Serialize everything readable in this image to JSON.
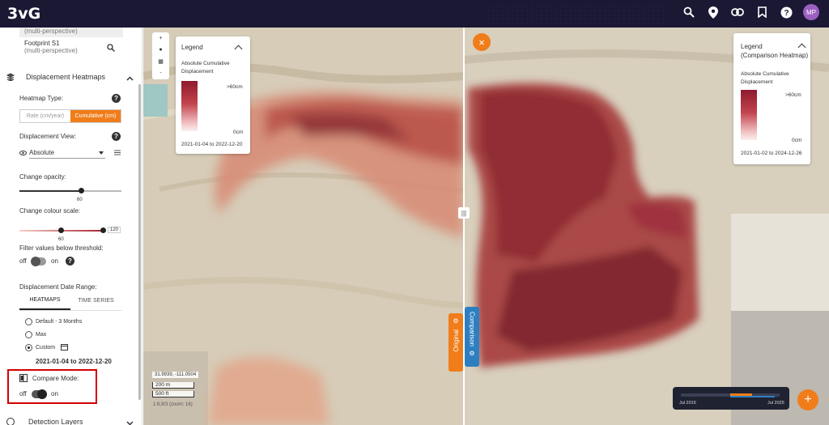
{
  "app": {
    "logo": "3vG",
    "avatar_initials": "MP"
  },
  "sidebar": {
    "prev_item_sub": "(multi-perspective)",
    "footprint": {
      "name": "Footprint S1",
      "sub": "(multi-perspective)"
    },
    "section_title": "Displacement Heatmaps",
    "heatmap_type_label": "Heatmap Type:",
    "heatmap_type_options": [
      "Rate (cm/year)",
      "Cumulative (cm)"
    ],
    "displacement_view_label": "Displacement View:",
    "displacement_view_value": "Absolute",
    "opacity_label": "Change opacity:",
    "opacity_value": "60",
    "opacity_fraction": 0.6,
    "colour_scale_label": "Change colour scale:",
    "colour_scale_min": "60",
    "colour_scale_max": "120",
    "filter_label": "Filter values below threshold:",
    "filter_off": "off",
    "filter_on": "on",
    "date_range_label": "Displacement Date Range:",
    "tabs": [
      "HEATMAPS",
      "TIME SERIES"
    ],
    "radio_default": "Default - 3 Months",
    "radio_max": "Max",
    "radio_custom": "Custom",
    "date_range_value": "2021-01-04 to 2022-12-20",
    "compare_label": "Compare Mode:",
    "compare_off": "off",
    "compare_on": "on",
    "detection_layers": "Detection Layers"
  },
  "map": {
    "legend_left": {
      "title": "Legend",
      "subtitle": "Absolute Cumulative Displacement",
      "max_label": ">60cm",
      "min_label": "0cm",
      "date_range": "2021-01-04 to 2022-12-20"
    },
    "legend_right": {
      "title": "Legend",
      "title2": "(Comparison Heatmap)",
      "subtitle": "Absolute Cumulative Displacement",
      "max_label": ">60cm",
      "min_label": "0cm",
      "date_range": "2021-01-02 to 2024-12-26"
    },
    "original_label": "Original",
    "comparison_label": "Comparison",
    "coordinates": "31.9939, -111.0504",
    "scale_m": "200 m",
    "scale_ft": "500 ft",
    "zoom_text": "1:6,9/3 (zoom: 16)",
    "timeline_start": "Jul 2016",
    "timeline_end": "Jul 2025"
  },
  "colors": {
    "accent": "#f07d1a",
    "compare": "#2d7fc1",
    "topbar": "#1b1834",
    "heat_dark": "#8e1a2e"
  }
}
